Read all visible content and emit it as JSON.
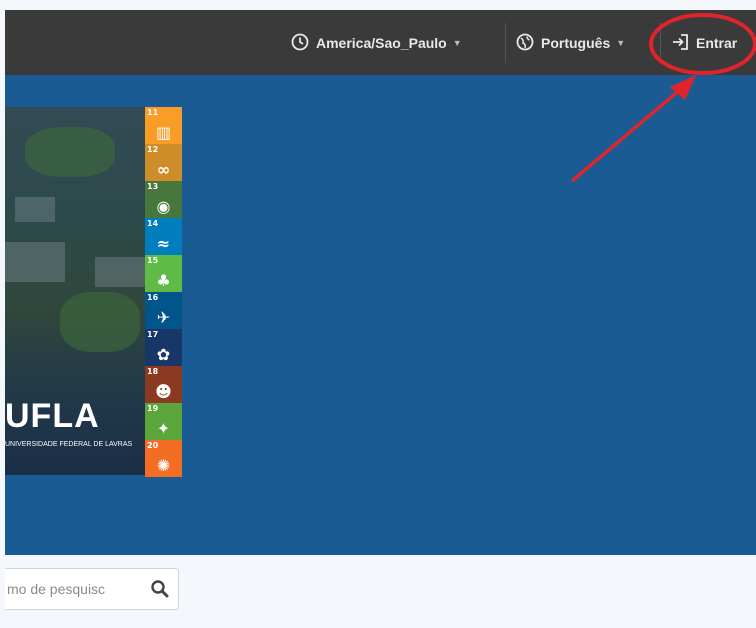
{
  "topbar": {
    "timezone_label": "America/Sao_Paulo",
    "language_label": "Português",
    "login_label": "Entrar"
  },
  "hero": {
    "logo_text": "UFLA",
    "logo_subtitle": "UNIVERSIDADE FEDERAL DE LAVRAS",
    "sdg_numbers": [
      "11",
      "12",
      "13",
      "14",
      "15",
      "16",
      "17",
      "18",
      "19",
      "20"
    ]
  },
  "search": {
    "placeholder": "mo de pesquisc"
  },
  "colors": {
    "topbar": "#3a3a3a",
    "hero": "#1b5b94",
    "annotation": "#e0242b"
  }
}
